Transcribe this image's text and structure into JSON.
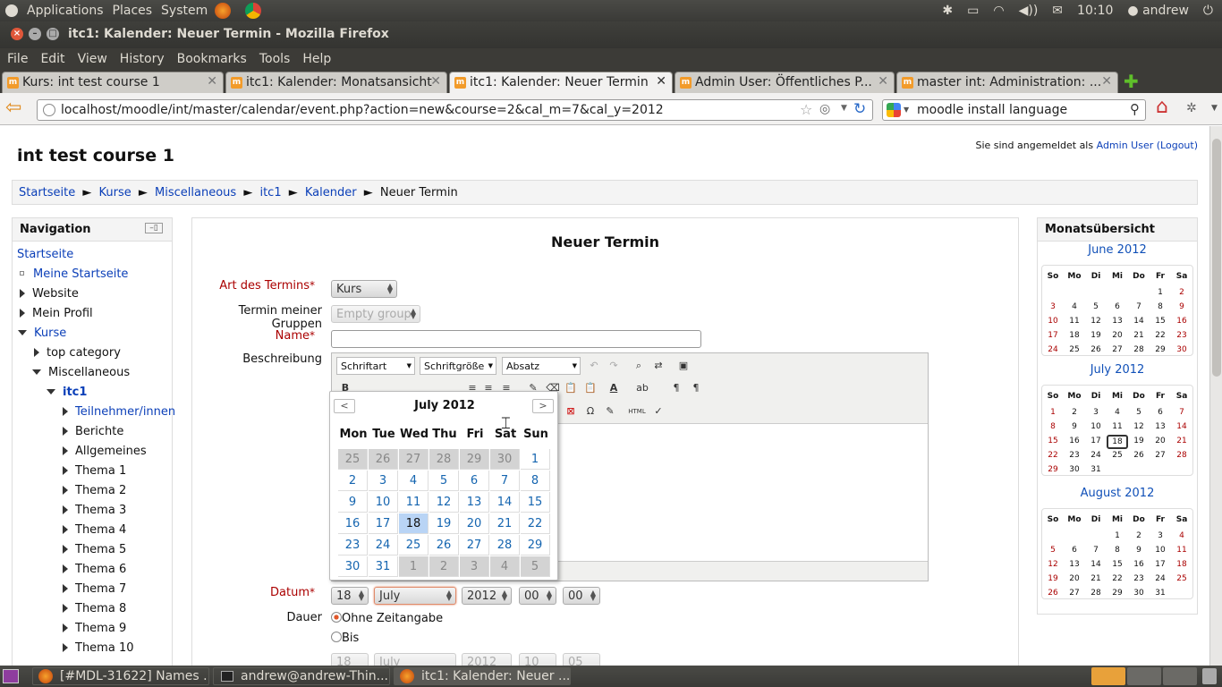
{
  "panel": {
    "applications": "Applications",
    "places": "Places",
    "system": "System",
    "time": "10:10",
    "user": "andrew"
  },
  "window_title": "itc1: Kalender: Neuer Termin - Mozilla Firefox",
  "menubar": [
    "File",
    "Edit",
    "View",
    "History",
    "Bookmarks",
    "Tools",
    "Help"
  ],
  "tabs": [
    {
      "label": "Kurs: int test course 1"
    },
    {
      "label": "itc1: Kalender: Monatsansicht"
    },
    {
      "label": "itc1: Kalender: Neuer Termin"
    },
    {
      "label": "Admin User: Öffentliches P..."
    },
    {
      "label": "master int: Administration: ..."
    }
  ],
  "url": "localhost/moodle/int/master/calendar/event.php?action=new&course=2&cal_m=7&cal_y=2012",
  "search_value": "moodle install language",
  "page": {
    "course_title": "int test course 1",
    "login_text": "Sie sind angemeldet als",
    "login_user": "Admin User",
    "logout": "(Logout)",
    "breadcrumb": [
      "Startseite",
      "Kurse",
      "Miscellaneous",
      "itc1",
      "Kalender",
      "Neuer Termin"
    ],
    "sep": "►"
  },
  "navigation": {
    "title": "Navigation",
    "items": [
      "Startseite",
      "Meine Startseite",
      "Website",
      "Mein Profil",
      "Kurse",
      "top category",
      "Miscellaneous",
      "itc1",
      "Teilnehmer/innen",
      "Berichte",
      "Allgemeines",
      "Thema 1",
      "Thema 2",
      "Thema 3",
      "Thema 4",
      "Thema 5",
      "Thema 6",
      "Thema 7",
      "Thema 8",
      "Thema 9",
      "Thema 10"
    ]
  },
  "form": {
    "heading": "Neuer Termin",
    "art_label": "Art des Termins",
    "art_value": "Kurs",
    "gruppe_label": "Termin meiner Gruppen",
    "gruppe_value": "Empty group",
    "name_label": "Name",
    "name_value": "",
    "beschreibung_label": "Beschreibung",
    "font_select": "Schriftart",
    "size_select": "Schriftgröße",
    "format_select": "Absatz",
    "datum_label": "Datum",
    "datum": {
      "day": "18",
      "month": "July",
      "year": "2012",
      "hour": "00",
      "minute": "00"
    },
    "dauer_label": "Dauer",
    "dauer_opt1": "Ohne Zeitangabe",
    "dauer_opt2": "Bis",
    "bis": {
      "day": "18",
      "month": "July",
      "year": "2012",
      "hour": "10",
      "minute": "05"
    }
  },
  "calendar_popup": {
    "title": "July 2012",
    "prev": "<",
    "next": ">",
    "weekdays": [
      "Mon",
      "Tue",
      "Wed",
      "Thu",
      "Fri",
      "Sat",
      "Sun"
    ],
    "weeks": [
      [
        "25",
        "26",
        "27",
        "28",
        "29",
        "30",
        "1"
      ],
      [
        "2",
        "3",
        "4",
        "5",
        "6",
        "7",
        "8"
      ],
      [
        "9",
        "10",
        "11",
        "12",
        "13",
        "14",
        "15"
      ],
      [
        "16",
        "17",
        "18",
        "19",
        "20",
        "21",
        "22"
      ],
      [
        "23",
        "24",
        "25",
        "26",
        "27",
        "28",
        "29"
      ],
      [
        "30",
        "31",
        "1",
        "2",
        "3",
        "4",
        "5"
      ]
    ],
    "selected": "18"
  },
  "monatsuebersicht": {
    "title": "Monatsübersicht",
    "weekdays": [
      "So",
      "Mo",
      "Di",
      "Mi",
      "Do",
      "Fr",
      "Sa"
    ],
    "months": [
      {
        "title": "June 2012",
        "weeks": [
          [
            "",
            "",
            "",
            "",
            "",
            "1",
            "2"
          ],
          [
            "3",
            "4",
            "5",
            "6",
            "7",
            "8",
            "9"
          ],
          [
            "10",
            "11",
            "12",
            "13",
            "14",
            "15",
            "16"
          ],
          [
            "17",
            "18",
            "19",
            "20",
            "21",
            "22",
            "23"
          ],
          [
            "24",
            "25",
            "26",
            "27",
            "28",
            "29",
            "30"
          ]
        ]
      },
      {
        "title": "July 2012",
        "weeks": [
          [
            "1",
            "2",
            "3",
            "4",
            "5",
            "6",
            "7"
          ],
          [
            "8",
            "9",
            "10",
            "11",
            "12",
            "13",
            "14"
          ],
          [
            "15",
            "16",
            "17",
            "18",
            "19",
            "20",
            "21"
          ],
          [
            "22",
            "23",
            "24",
            "25",
            "26",
            "27",
            "28"
          ],
          [
            "29",
            "30",
            "31",
            "",
            "",
            "",
            ""
          ]
        ],
        "today": "18"
      },
      {
        "title": "August 2012",
        "weeks": [
          [
            "",
            "",
            "",
            "1",
            "2",
            "3",
            "4"
          ],
          [
            "5",
            "6",
            "7",
            "8",
            "9",
            "10",
            "11"
          ],
          [
            "12",
            "13",
            "14",
            "15",
            "16",
            "17",
            "18"
          ],
          [
            "19",
            "20",
            "21",
            "22",
            "23",
            "24",
            "25"
          ],
          [
            "26",
            "27",
            "28",
            "29",
            "30",
            "31",
            ""
          ]
        ]
      }
    ]
  },
  "taskbar": [
    {
      "label": "[#MDL-31622] Names ..."
    },
    {
      "label": "andrew@andrew-Thin..."
    },
    {
      "label": "itc1: Kalender: Neuer ..."
    }
  ],
  "colors": {
    "link": "#0b3fb8",
    "required": "#aa0000",
    "panel": "#3c3b37",
    "calendar_selected": "#b9d4f5"
  }
}
